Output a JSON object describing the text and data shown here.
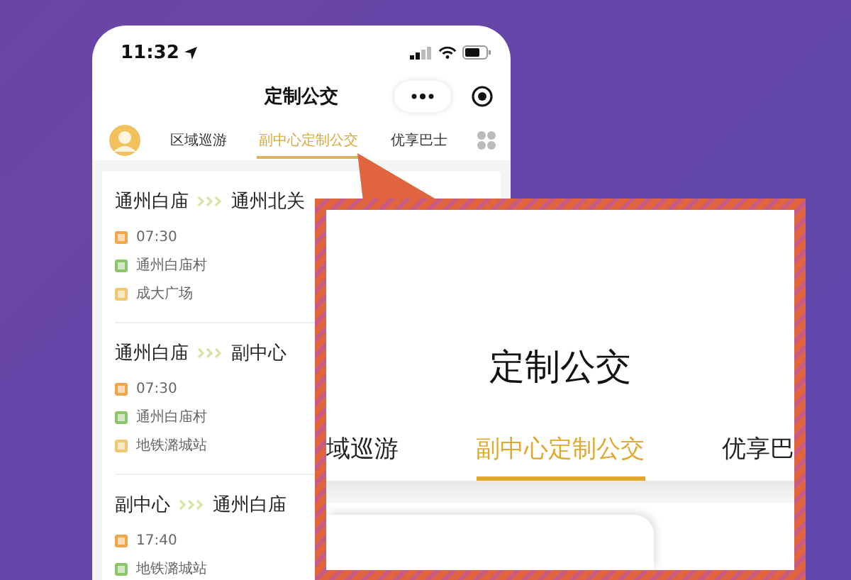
{
  "status_bar": {
    "time": "11:32"
  },
  "nav": {
    "title": "定制公交"
  },
  "tabs": [
    {
      "label": "区域巡游",
      "selected": false
    },
    {
      "label": "副中心定制公交",
      "selected": true
    },
    {
      "label": "优享巴士",
      "selected": false
    }
  ],
  "routes": [
    {
      "from": "通州白庙",
      "to": "通州北关",
      "time": "07:30",
      "stops": [
        {
          "kind": "start",
          "name": "通州白庙村"
        },
        {
          "kind": "end",
          "name": "成大广场"
        }
      ]
    },
    {
      "from": "通州白庙",
      "to": "副中心",
      "time": "07:30",
      "stops": [
        {
          "kind": "start",
          "name": "通州白庙村"
        },
        {
          "kind": "end",
          "name": "地铁潞城站"
        }
      ]
    },
    {
      "from": "副中心",
      "to": "通州白庙",
      "time": "17:40",
      "stops": [
        {
          "kind": "start",
          "name": "地铁潞城站"
        }
      ]
    }
  ],
  "callout": {
    "title": "定制公交",
    "tabs": [
      {
        "label": "域巡游",
        "selected": false
      },
      {
        "label": "副中心定制公交",
        "selected": true
      },
      {
        "label": "优享巴",
        "selected": false
      }
    ]
  }
}
